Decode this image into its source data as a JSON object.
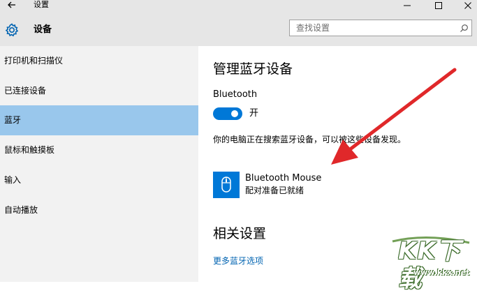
{
  "titlebar": {
    "title": "设置",
    "back_icon": "arrow-left-icon",
    "min_icon": "minimize-icon",
    "max_icon": "maximize-icon",
    "close_icon": "close-icon"
  },
  "header": {
    "title": "设备",
    "icon": "gear-icon",
    "search_placeholder": "查找设置",
    "search_icon": "search-icon"
  },
  "sidebar": {
    "items": [
      {
        "label": "打印机和扫描仪",
        "selected": false
      },
      {
        "label": "已连接设备",
        "selected": false
      },
      {
        "label": "蓝牙",
        "selected": true
      },
      {
        "label": "鼠标和触摸板",
        "selected": false
      },
      {
        "label": "输入",
        "selected": false
      },
      {
        "label": "自动播放",
        "selected": false
      }
    ]
  },
  "main": {
    "heading": "管理蓝牙设备",
    "bluetooth_label": "Bluetooth",
    "toggle_state": "开",
    "toggle_on": true,
    "status_message": "你的电脑正在搜索蓝牙设备，可以被这些设备发现。",
    "device": {
      "name": "Bluetooth Mouse",
      "status": "配对准备已就绪",
      "icon": "mouse-icon"
    },
    "related_heading": "相关设置",
    "more_link": "更多蓝牙选项"
  },
  "colors": {
    "accent": "#0078d7",
    "selected_bg": "#99c7ec",
    "sidebar_bg": "#f2f2f2",
    "header_bg": "#e6e6e6",
    "link": "#0063b1",
    "arrow": "#e0282a"
  },
  "watermark": {
    "logo_text": "KK下载",
    "url": "www.kkx.net"
  }
}
